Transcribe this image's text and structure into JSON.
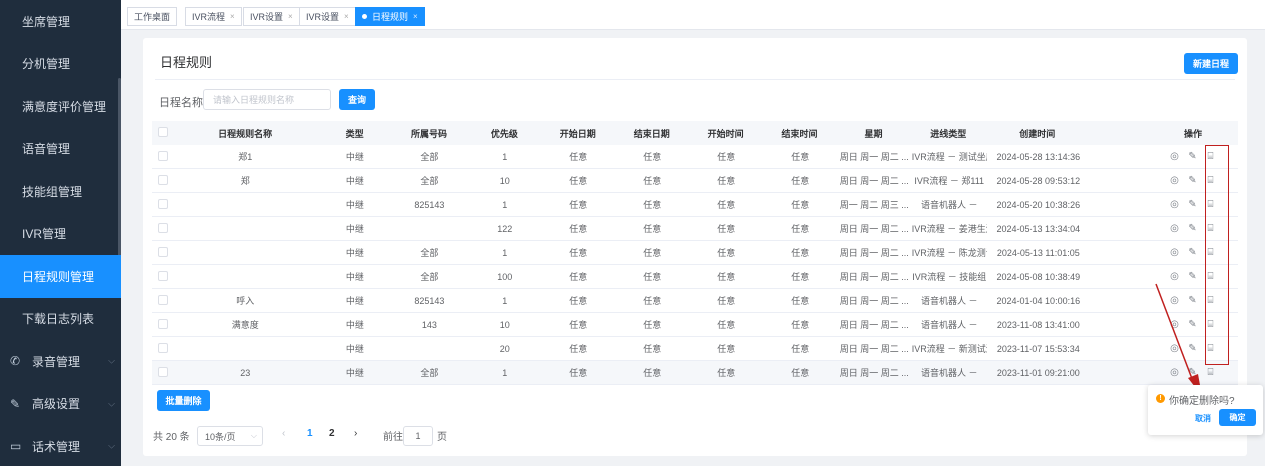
{
  "sidebar": {
    "items": [
      {
        "label": "坐席管理",
        "icon": ""
      },
      {
        "label": "分机管理",
        "icon": ""
      },
      {
        "label": "满意度评价管理",
        "icon": ""
      },
      {
        "label": "语音管理",
        "icon": ""
      },
      {
        "label": "技能组管理",
        "icon": ""
      },
      {
        "label": "IVR管理",
        "icon": ""
      },
      {
        "label": "日程规则管理",
        "icon": "",
        "active": true
      },
      {
        "label": "下载日志列表",
        "icon": ""
      },
      {
        "label": "录音管理",
        "icon": "phone-icon",
        "glyph": "✆"
      },
      {
        "label": "高级设置",
        "icon": "pen-icon",
        "glyph": "✎"
      },
      {
        "label": "话术管理",
        "icon": "chat-icon",
        "glyph": "▭"
      }
    ]
  },
  "tabs": [
    {
      "label": "工作桌面",
      "closable": false
    },
    {
      "label": "IVR流程",
      "closable": true
    },
    {
      "label": "IVR设置",
      "closable": true
    },
    {
      "label": "IVR设置",
      "closable": true
    },
    {
      "label": "日程规则",
      "closable": true,
      "active": true
    }
  ],
  "card": {
    "title": "日程规则",
    "new_button": "新建日程",
    "search_label": "日程名称",
    "search_placeholder": "请输入日程规则名称",
    "query_button": "查询",
    "batch_delete": "批量删除"
  },
  "table": {
    "columns": [
      "日程规则名称",
      "类型",
      "所属号码",
      "优先级",
      "开始日期",
      "结束日期",
      "开始时间",
      "结束时间",
      "星期",
      "进线类型",
      "创建时间",
      "操作"
    ],
    "rows": [
      [
        "郑1",
        "中继",
        "全部",
        "1",
        "任意",
        "任意",
        "任意",
        "任意",
        "周日 周一 周二 ...",
        "IVR流程 － 测试坐席...",
        "2024-05-28 13:14:36"
      ],
      [
        "郑",
        "中继",
        "全部",
        "10",
        "任意",
        "任意",
        "任意",
        "任意",
        "周日 周一 周二 ...",
        "IVR流程 － 郑111",
        "2024-05-28 09:53:12"
      ],
      [
        "",
        "中继",
        "825143",
        "1",
        "任意",
        "任意",
        "任意",
        "任意",
        "周一 周二 周三 ...",
        "语音机器人 －",
        "2024-05-20 10:38:26"
      ],
      [
        "",
        "中继",
        "",
        "122",
        "任意",
        "任意",
        "任意",
        "任意",
        "周日 周一 周二 ...",
        "IVR流程 － 姜港生测...",
        "2024-05-13 13:34:04"
      ],
      [
        "",
        "中继",
        "全部",
        "1",
        "任意",
        "任意",
        "任意",
        "任意",
        "周日 周一 周二 ...",
        "IVR流程 － 陈龙测试...",
        "2024-05-13 11:01:05"
      ],
      [
        "",
        "中继",
        "全部",
        "100",
        "任意",
        "任意",
        "任意",
        "任意",
        "周日 周一 周二 ...",
        "IVR流程 － 技能组",
        "2024-05-08 10:38:49"
      ],
      [
        "呼入",
        "中继",
        "825143",
        "1",
        "任意",
        "任意",
        "任意",
        "任意",
        "周日 周一 周二 ...",
        "语音机器人 －",
        "2024-01-04 10:00:16"
      ],
      [
        "满意度",
        "中继",
        "143",
        "10",
        "任意",
        "任意",
        "任意",
        "任意",
        "周日 周一 周二 ...",
        "语音机器人 －",
        "2023-11-08 13:41:00"
      ],
      [
        "",
        "中继",
        "",
        "20",
        "任意",
        "任意",
        "任意",
        "任意",
        "周日 周一 周二 ...",
        "IVR流程 － 新测试满...",
        "2023-11-07 15:53:34"
      ],
      [
        "23",
        "中继",
        "全部",
        "1",
        "任意",
        "任意",
        "任意",
        "任意",
        "周日 周一 周二 ...",
        "语音机器人 －",
        "2023-11-01 09:21:00"
      ]
    ]
  },
  "pager": {
    "total": "共 20 条",
    "page_size": "10条/页",
    "pages": [
      "1",
      "2"
    ],
    "current": "1",
    "goto_label": "前往",
    "goto_value": "1",
    "goto_suffix": "页"
  },
  "popconfirm": {
    "question": "你确定删除吗?",
    "cancel": "取消",
    "confirm": "确定"
  },
  "colors": {
    "sidebar_bg": "#1f2d3d",
    "primary": "#1890ff",
    "annotation_red": "#c0201f",
    "warning": "#ff9900"
  }
}
